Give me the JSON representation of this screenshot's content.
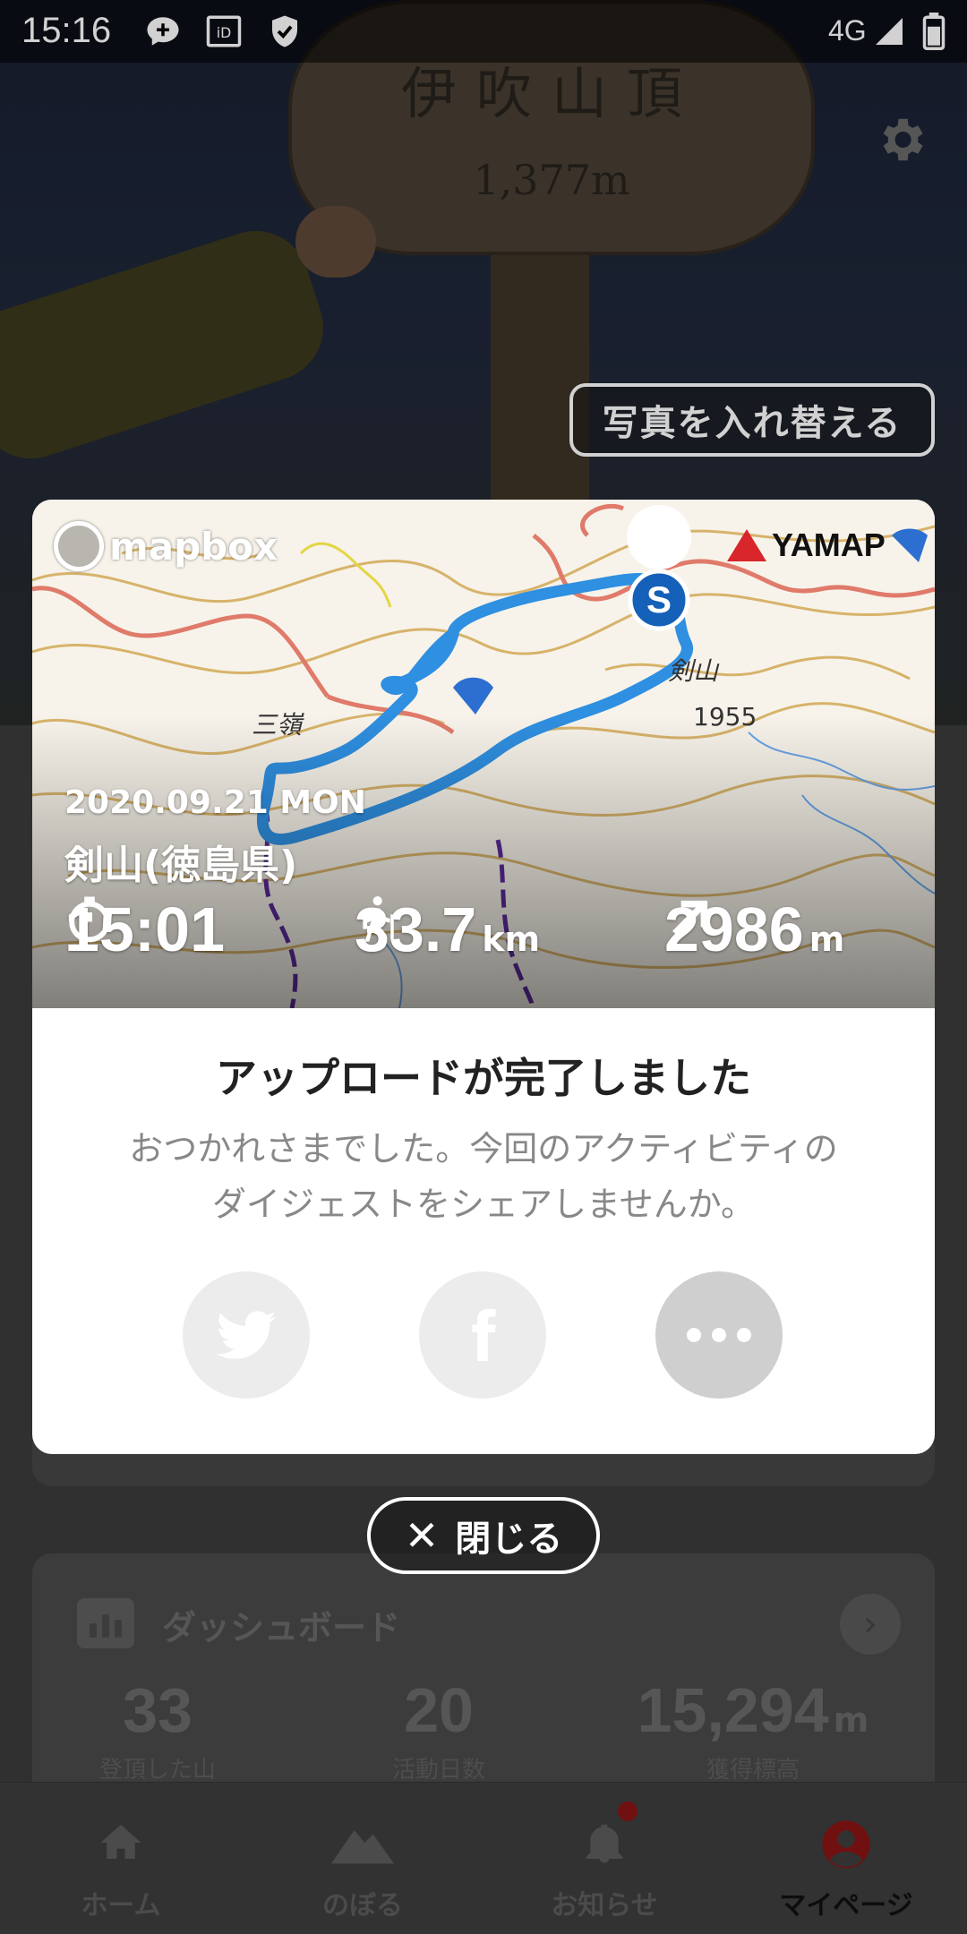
{
  "status_bar": {
    "time": "15:16",
    "network": "4G",
    "icons": [
      "chat-plus-icon",
      "id-card-icon",
      "shield-check-icon",
      "signal-icon",
      "battery-icon"
    ]
  },
  "hero": {
    "sign_text": "伊吹山頂",
    "sign_altitude": "1,377m",
    "swap_photo_label": "写真を入れ替える",
    "settings_icon": "gear-icon"
  },
  "modal": {
    "map": {
      "provider_logo": "mapbox",
      "brand_logo": "YAMAP",
      "labels": [
        "三嶺",
        "剣山",
        "1955"
      ],
      "start_marker": "S",
      "route_color": "#2f8fe0"
    },
    "activity": {
      "date": "2020.09.21 MON",
      "name": "剣山(徳島県)",
      "duration": "15:01",
      "distance_value": "33.7",
      "distance_unit": "km",
      "elevation_value": "2986",
      "elevation_unit": "m"
    },
    "title": "アップロードが完了しました",
    "message_line1": "おつかれさまでした。今回のアクティビティの",
    "message_line2": "ダイジェストをシェアしませんか。",
    "share_buttons": [
      {
        "name": "twitter",
        "icon": "twitter-bird-icon"
      },
      {
        "name": "facebook",
        "icon": "facebook-f-icon"
      },
      {
        "name": "more",
        "icon": "more-dots-icon"
      }
    ]
  },
  "close_label": "閉じる",
  "dashboard": {
    "title": "ダッシュボード",
    "stats": [
      {
        "value": "33",
        "unit": "",
        "label": "登頂した山"
      },
      {
        "value": "20",
        "unit": "",
        "label": "活動日数"
      },
      {
        "value": "15,294",
        "unit": "m",
        "label": "獲得標高"
      }
    ]
  },
  "bottom_nav": {
    "items": [
      {
        "label": "ホーム",
        "icon": "home-icon"
      },
      {
        "label": "のぼる",
        "icon": "mountain-icon"
      },
      {
        "label": "お知らせ",
        "icon": "bell-icon"
      },
      {
        "label": "マイページ",
        "icon": "user-icon"
      }
    ],
    "active_index": 3
  },
  "colors": {
    "accent_red": "#d8262a",
    "route_blue": "#2f8fe0",
    "marker_blue": "#1560b8",
    "nav_active_icon": "#8a1414"
  }
}
